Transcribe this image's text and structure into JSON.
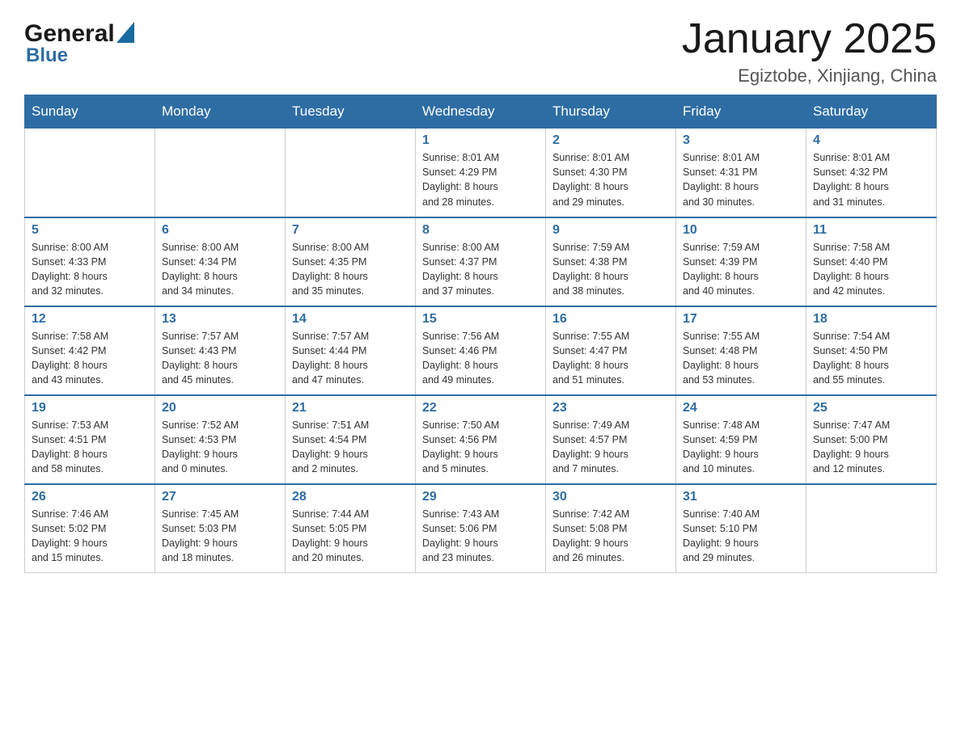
{
  "header": {
    "logo_main": "General",
    "logo_sub": "Blue",
    "title": "January 2025",
    "subtitle": "Egiztobe, Xinjiang, China"
  },
  "days_of_week": [
    "Sunday",
    "Monday",
    "Tuesday",
    "Wednesday",
    "Thursday",
    "Friday",
    "Saturday"
  ],
  "weeks": [
    {
      "days": [
        {
          "num": "",
          "info": ""
        },
        {
          "num": "",
          "info": ""
        },
        {
          "num": "",
          "info": ""
        },
        {
          "num": "1",
          "info": "Sunrise: 8:01 AM\nSunset: 4:29 PM\nDaylight: 8 hours\nand 28 minutes."
        },
        {
          "num": "2",
          "info": "Sunrise: 8:01 AM\nSunset: 4:30 PM\nDaylight: 8 hours\nand 29 minutes."
        },
        {
          "num": "3",
          "info": "Sunrise: 8:01 AM\nSunset: 4:31 PM\nDaylight: 8 hours\nand 30 minutes."
        },
        {
          "num": "4",
          "info": "Sunrise: 8:01 AM\nSunset: 4:32 PM\nDaylight: 8 hours\nand 31 minutes."
        }
      ]
    },
    {
      "days": [
        {
          "num": "5",
          "info": "Sunrise: 8:00 AM\nSunset: 4:33 PM\nDaylight: 8 hours\nand 32 minutes."
        },
        {
          "num": "6",
          "info": "Sunrise: 8:00 AM\nSunset: 4:34 PM\nDaylight: 8 hours\nand 34 minutes."
        },
        {
          "num": "7",
          "info": "Sunrise: 8:00 AM\nSunset: 4:35 PM\nDaylight: 8 hours\nand 35 minutes."
        },
        {
          "num": "8",
          "info": "Sunrise: 8:00 AM\nSunset: 4:37 PM\nDaylight: 8 hours\nand 37 minutes."
        },
        {
          "num": "9",
          "info": "Sunrise: 7:59 AM\nSunset: 4:38 PM\nDaylight: 8 hours\nand 38 minutes."
        },
        {
          "num": "10",
          "info": "Sunrise: 7:59 AM\nSunset: 4:39 PM\nDaylight: 8 hours\nand 40 minutes."
        },
        {
          "num": "11",
          "info": "Sunrise: 7:58 AM\nSunset: 4:40 PM\nDaylight: 8 hours\nand 42 minutes."
        }
      ]
    },
    {
      "days": [
        {
          "num": "12",
          "info": "Sunrise: 7:58 AM\nSunset: 4:42 PM\nDaylight: 8 hours\nand 43 minutes."
        },
        {
          "num": "13",
          "info": "Sunrise: 7:57 AM\nSunset: 4:43 PM\nDaylight: 8 hours\nand 45 minutes."
        },
        {
          "num": "14",
          "info": "Sunrise: 7:57 AM\nSunset: 4:44 PM\nDaylight: 8 hours\nand 47 minutes."
        },
        {
          "num": "15",
          "info": "Sunrise: 7:56 AM\nSunset: 4:46 PM\nDaylight: 8 hours\nand 49 minutes."
        },
        {
          "num": "16",
          "info": "Sunrise: 7:55 AM\nSunset: 4:47 PM\nDaylight: 8 hours\nand 51 minutes."
        },
        {
          "num": "17",
          "info": "Sunrise: 7:55 AM\nSunset: 4:48 PM\nDaylight: 8 hours\nand 53 minutes."
        },
        {
          "num": "18",
          "info": "Sunrise: 7:54 AM\nSunset: 4:50 PM\nDaylight: 8 hours\nand 55 minutes."
        }
      ]
    },
    {
      "days": [
        {
          "num": "19",
          "info": "Sunrise: 7:53 AM\nSunset: 4:51 PM\nDaylight: 8 hours\nand 58 minutes."
        },
        {
          "num": "20",
          "info": "Sunrise: 7:52 AM\nSunset: 4:53 PM\nDaylight: 9 hours\nand 0 minutes."
        },
        {
          "num": "21",
          "info": "Sunrise: 7:51 AM\nSunset: 4:54 PM\nDaylight: 9 hours\nand 2 minutes."
        },
        {
          "num": "22",
          "info": "Sunrise: 7:50 AM\nSunset: 4:56 PM\nDaylight: 9 hours\nand 5 minutes."
        },
        {
          "num": "23",
          "info": "Sunrise: 7:49 AM\nSunset: 4:57 PM\nDaylight: 9 hours\nand 7 minutes."
        },
        {
          "num": "24",
          "info": "Sunrise: 7:48 AM\nSunset: 4:59 PM\nDaylight: 9 hours\nand 10 minutes."
        },
        {
          "num": "25",
          "info": "Sunrise: 7:47 AM\nSunset: 5:00 PM\nDaylight: 9 hours\nand 12 minutes."
        }
      ]
    },
    {
      "days": [
        {
          "num": "26",
          "info": "Sunrise: 7:46 AM\nSunset: 5:02 PM\nDaylight: 9 hours\nand 15 minutes."
        },
        {
          "num": "27",
          "info": "Sunrise: 7:45 AM\nSunset: 5:03 PM\nDaylight: 9 hours\nand 18 minutes."
        },
        {
          "num": "28",
          "info": "Sunrise: 7:44 AM\nSunset: 5:05 PM\nDaylight: 9 hours\nand 20 minutes."
        },
        {
          "num": "29",
          "info": "Sunrise: 7:43 AM\nSunset: 5:06 PM\nDaylight: 9 hours\nand 23 minutes."
        },
        {
          "num": "30",
          "info": "Sunrise: 7:42 AM\nSunset: 5:08 PM\nDaylight: 9 hours\nand 26 minutes."
        },
        {
          "num": "31",
          "info": "Sunrise: 7:40 AM\nSunset: 5:10 PM\nDaylight: 9 hours\nand 29 minutes."
        },
        {
          "num": "",
          "info": ""
        }
      ]
    }
  ]
}
